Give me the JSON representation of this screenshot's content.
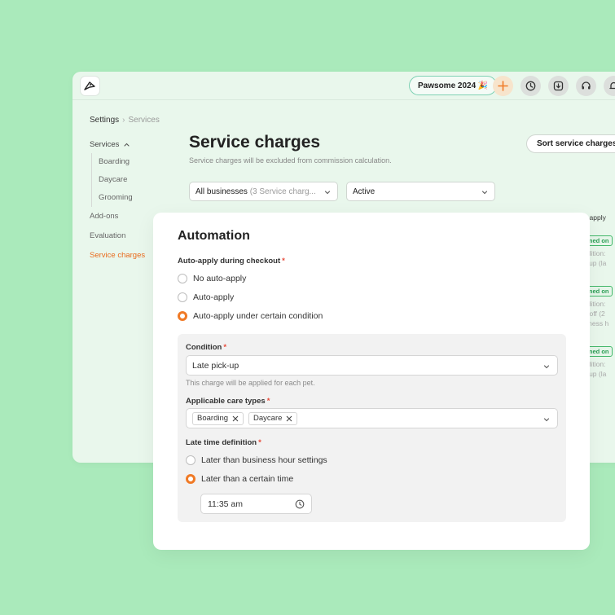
{
  "topbar": {
    "badge_label": "Pawsome 2024 🎉",
    "icons": [
      "logo-icon",
      "plus-icon",
      "clock-icon",
      "download-icon",
      "headset-icon",
      "bell-icon"
    ]
  },
  "breadcrumb": {
    "root": "Settings",
    "current": "Services"
  },
  "sidebar": {
    "group_label": "Services",
    "sub_items": [
      "Boarding",
      "Daycare",
      "Grooming"
    ],
    "items": [
      "Add-ons",
      "Evaluation",
      "Service charges"
    ],
    "active_item": "Service charges"
  },
  "main": {
    "title": "Service charges",
    "description": "Service charges will be excluded from commission calculation.",
    "sort_button": "Sort service charges",
    "filter_business": {
      "value": "All businesses",
      "count_text": "(3 Service charg..."
    },
    "filter_status": {
      "value": "Active"
    }
  },
  "background_table": {
    "header": "o-apply",
    "rows": [
      {
        "tag": "rned on",
        "lines": [
          "ndition:",
          "k-up (la"
        ]
      },
      {
        "tag": "rned on",
        "lines": [
          "ndition:",
          "p-off (2",
          "siness h"
        ]
      },
      {
        "tag": "rned on",
        "lines": [
          "ndition:",
          "k-up (la"
        ]
      }
    ]
  },
  "modal": {
    "title": "Automation",
    "auto_apply_label": "Auto-apply during checkout",
    "options": [
      "No auto-apply",
      "Auto-apply",
      "Auto-apply under certain condition"
    ],
    "selected_option": 2,
    "condition": {
      "label": "Condition",
      "value": "Late pick-up",
      "hint": "This charge will be applied for each pet."
    },
    "care_types": {
      "label": "Applicable care types",
      "chips": [
        "Boarding",
        "Daycare"
      ]
    },
    "late_time": {
      "label": "Late time definition",
      "options": [
        "Later than business hour settings",
        "Later than a certain time"
      ],
      "selected_option": 1,
      "time_value": "11:35 am"
    }
  },
  "colors": {
    "accent": "#f07a26",
    "background": "#aaeabb",
    "success": "#2d9f56"
  }
}
